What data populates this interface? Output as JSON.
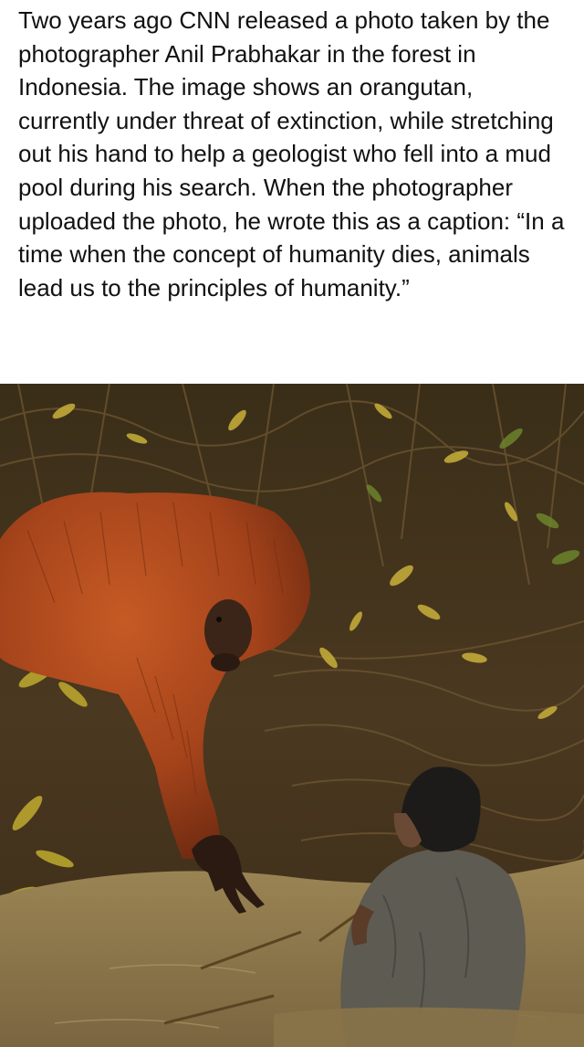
{
  "post": {
    "caption": "Two years ago CNN released a photo taken by the photographer Anil Prabhakar in the forest in Indonesia. The image shows an orangutan, currently under threat of extinction, while stretching out his hand to help a geologist who fell into a mud pool during his search. When the photographer uploaded the photo, he wrote this as a caption: “In a time when the concept of humanity dies, animals lead us to the principles of humanity.”"
  },
  "photo": {
    "colors": {
      "foliage_dark": "#2b2416",
      "foliage_brown": "#5a4322",
      "foliage_yellow": "#c9b23a",
      "foliage_green": "#6f8a2e",
      "orangutan": "#a9471d",
      "orangutan_dark": "#6e2a10",
      "mud": "#8a7348",
      "mud_light": "#a38d60",
      "shirt": "#5d5b52",
      "hair": "#1d1b1a"
    }
  }
}
